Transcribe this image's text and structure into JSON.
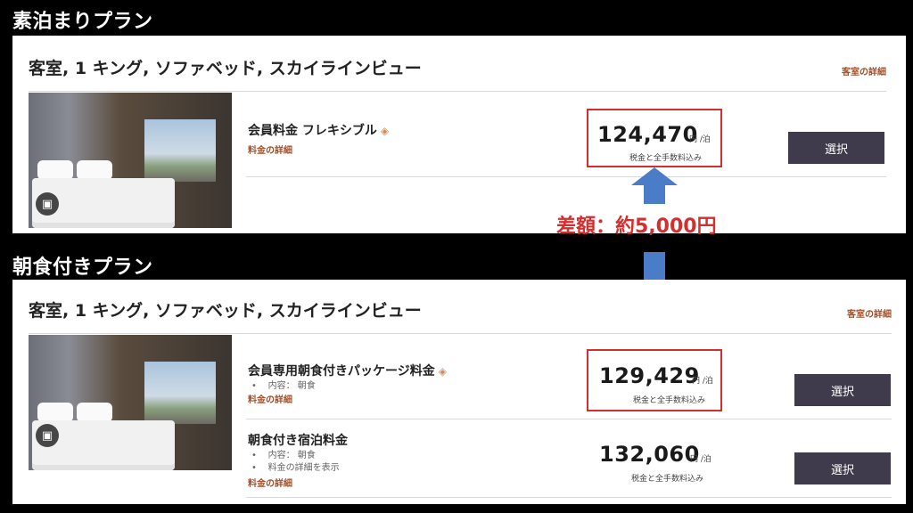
{
  "sections": {
    "room_only": {
      "heading": "素泊まりプラン",
      "room_title": "客室, 1 キング, ソファベッド, スカイラインビュー",
      "room_link": "客室の詳細",
      "rates": [
        {
          "name": "会員料金 フレキシブル",
          "details_link": "料金の詳細",
          "price": "124,470",
          "unit": "円 /泊",
          "tax_note": "税金と全手数料込み",
          "button": "選択"
        }
      ]
    },
    "breakfast": {
      "heading": "朝食付きプラン",
      "room_title": "客室, 1 キング, ソファベッド, スカイラインビュー",
      "room_link": "客室の詳細",
      "rates": [
        {
          "name": "会員専用朝食付きパッケージ料金",
          "bullets": [
            "内容： 朝食"
          ],
          "details_link": "料金の詳細",
          "price": "129,429",
          "unit": "円 /泊",
          "tax_note": "税金と全手数料込み",
          "button": "選択"
        },
        {
          "name": "朝食付き宿泊料金",
          "bullets": [
            "内容： 朝食",
            "料金の詳細を表示"
          ],
          "details_link": "料金の詳細",
          "price": "132,060",
          "unit": "円 /泊",
          "tax_note": "税金と全手数料込み",
          "button": "選択"
        }
      ]
    }
  },
  "annotation": {
    "difference_label": "差額：約5,000円",
    "highlight_color": "#d32f2f",
    "arrow_color": "#4a7cc7"
  },
  "icons": {
    "tag": "price-tag-icon",
    "gallery": "gallery-icon"
  }
}
